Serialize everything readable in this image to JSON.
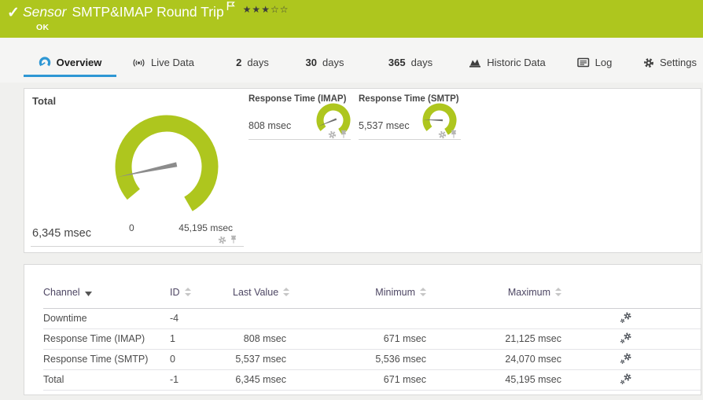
{
  "colors": {
    "status_green": "#aec61e",
    "accent_blue": "#2e97d4"
  },
  "header": {
    "status_check": "✓",
    "kind_label": "Sensor",
    "name": "SMTP&IMAP Round Trip",
    "status": "OK",
    "stars_filled": "★★★",
    "stars_empty": "☆☆"
  },
  "tabs": [
    {
      "label": "Overview"
    },
    {
      "label": "Live Data"
    },
    {
      "num": "2",
      "label": "days"
    },
    {
      "num": "30",
      "label": "days"
    },
    {
      "num": "365",
      "label": "days"
    },
    {
      "label": "Historic Data"
    },
    {
      "label": "Log"
    },
    {
      "label": "Settings"
    }
  ],
  "overview": {
    "total": {
      "title": "Total",
      "value": "6,345 msec",
      "min_label": "0",
      "max_label": "45,195 msec"
    },
    "imap": {
      "title": "Response Time (IMAP)",
      "value": "808 msec"
    },
    "smtp": {
      "title": "Response Time (SMTP)",
      "value": "5,537 msec"
    }
  },
  "channels": {
    "columns": [
      "Channel",
      "ID",
      "Last Value",
      "Minimum",
      "Maximum"
    ],
    "rows": [
      {
        "channel": "Downtime",
        "id": "-4",
        "last": "",
        "min": "",
        "max": ""
      },
      {
        "channel": "Response Time (IMAP)",
        "id": "1",
        "last": "808 msec",
        "min": "671 msec",
        "max": "21,125 msec"
      },
      {
        "channel": "Response Time (SMTP)",
        "id": "0",
        "last": "5,537 msec",
        "min": "5,536 msec",
        "max": "24,070 msec"
      },
      {
        "channel": "Total",
        "id": "-1",
        "last": "6,345 msec",
        "min": "671 msec",
        "max": "45,195 msec"
      }
    ]
  }
}
